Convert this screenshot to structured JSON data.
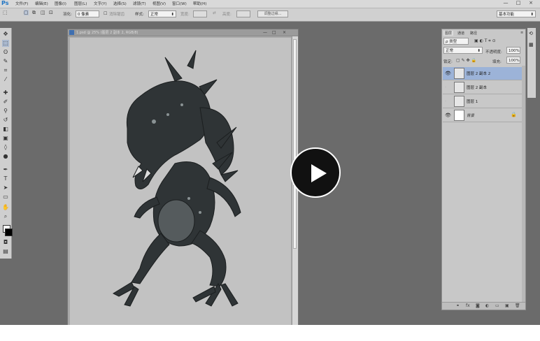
{
  "app": {
    "logo": "Ps"
  },
  "menu": [
    "文件(F)",
    "编辑(E)",
    "图像(I)",
    "图层(L)",
    "文字(Y)",
    "选择(S)",
    "滤镜(T)",
    "视图(V)",
    "窗口(W)",
    "帮助(H)"
  ],
  "window_controls": {
    "minimize": "—",
    "restore": "□",
    "close": "×"
  },
  "options_bar": {
    "feather_label": "羽化:",
    "feather_value": "0 像素",
    "antialias_label": "消除锯齿",
    "style_label": "样式:",
    "style_value": "正常",
    "width_label": "宽度:",
    "height_label": "高度:",
    "refine_edge": "调整边缘...",
    "workspace": "基本功能"
  },
  "document": {
    "title": "1.psd @ 25% (图层 2 副本 2, RGB/8)",
    "controls": {
      "minimize": "—",
      "restore": "□",
      "close": "×"
    }
  },
  "layers_panel": {
    "tabs": [
      "图层",
      "通道",
      "路径"
    ],
    "filter_label": "ρ 类型",
    "blend_mode": "正常",
    "opacity_label": "不透明度:",
    "opacity_value": "100%",
    "lock_label": "锁定:",
    "fill_label": "填充:",
    "fill_value": "100%",
    "layers": [
      {
        "name": "图层 2 副本 2",
        "visible": true,
        "selected": true
      },
      {
        "name": "图层 2 副本",
        "visible": false,
        "selected": false
      },
      {
        "name": "图层 1",
        "visible": false,
        "selected": false
      },
      {
        "name": "背景",
        "visible": true,
        "selected": false,
        "locked": true
      }
    ],
    "bottom_icons": [
      "link-icon",
      "fx-icon",
      "mask-icon",
      "adjustment-icon",
      "folder-icon",
      "new-layer-icon",
      "trash-icon"
    ]
  },
  "overlay": {
    "icon": "play-icon"
  },
  "colors": {
    "accent": "#1f75c4",
    "selected_layer": "#9cb3d8",
    "canvas": "#c2c2c2",
    "workspace": "#6b6b6b"
  }
}
